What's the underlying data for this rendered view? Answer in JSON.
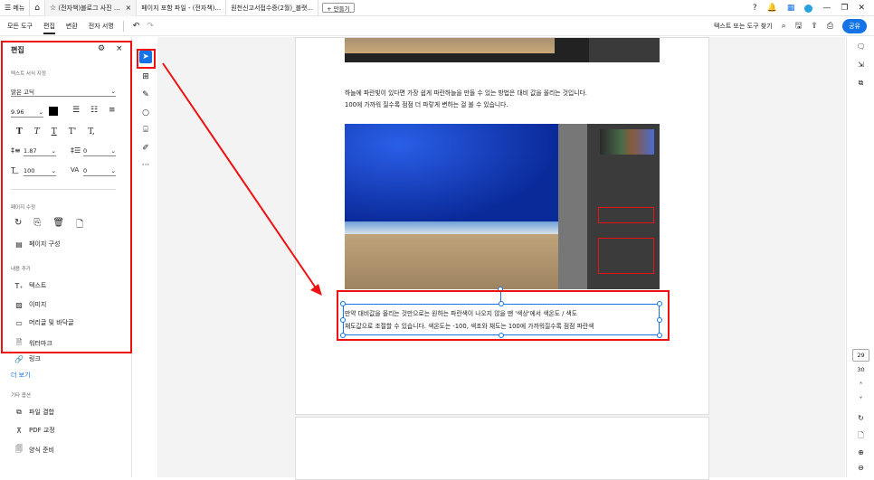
{
  "tabs": [
    {
      "label": "메뉴"
    },
    {
      "label": "(전자책)블로그 사진 ..."
    },
    {
      "label": "페이지 포함 파일 - (전자책)..."
    },
    {
      "label": "원천신고서접수증(2월)_블랫..."
    }
  ],
  "new_tab_label": "+ 만들기",
  "menus": [
    "모든 도구",
    "편집",
    "변환",
    "전자 서명"
  ],
  "search_tools": "텍스트 또는 도구 찾기",
  "share_label": "공유",
  "panel": {
    "title": "편집",
    "text_format_header": "텍스트 서식 지정",
    "font_name": "맑은 고딕",
    "font_size": "9.96",
    "line_spacing": "1.87",
    "paragraph_spacing": "0",
    "horizontal_scale": "100",
    "char_spacing": "0",
    "page_edit_header": "페이지 수정",
    "page_organize": "페이지 구성",
    "add_content_header": "내용 추가",
    "add_text": "텍스트",
    "add_image": "이미지",
    "header_footer": "머리글 및 바닥글",
    "watermark": "워터마크",
    "link": "링크",
    "more": "더 보기",
    "other_header": "기타 옵션",
    "combine": "파일 결합",
    "pdf_fix": "PDF 교정",
    "prepare_form": "양식 준비"
  },
  "doc": {
    "para1_line1": "하늘에 파란빛이 있다면 가장 쉽게 파란하늘을 만들 수 있는 방법은 대비 값을 올리는 것입니다.",
    "para1_line2": "100에 가까워 질수록 점점 더 파랗게 변하는 걸 볼 수 있습니다.",
    "para2_line1": "만약 대비값을 올리는 것만으로는 원하는 파란색이 나오지 않을 땐 '색상'에서 색온도 / 색도",
    "para2_line2": "채도값으로 조절할 수 있습니다. 색온도는 -100, 색조와 채도는 100에 가까워질수록 점점 파란색"
  },
  "page_num": "29",
  "page_total": "30",
  "colors": {
    "accent": "#1473e6",
    "highlight": "#e11111"
  }
}
